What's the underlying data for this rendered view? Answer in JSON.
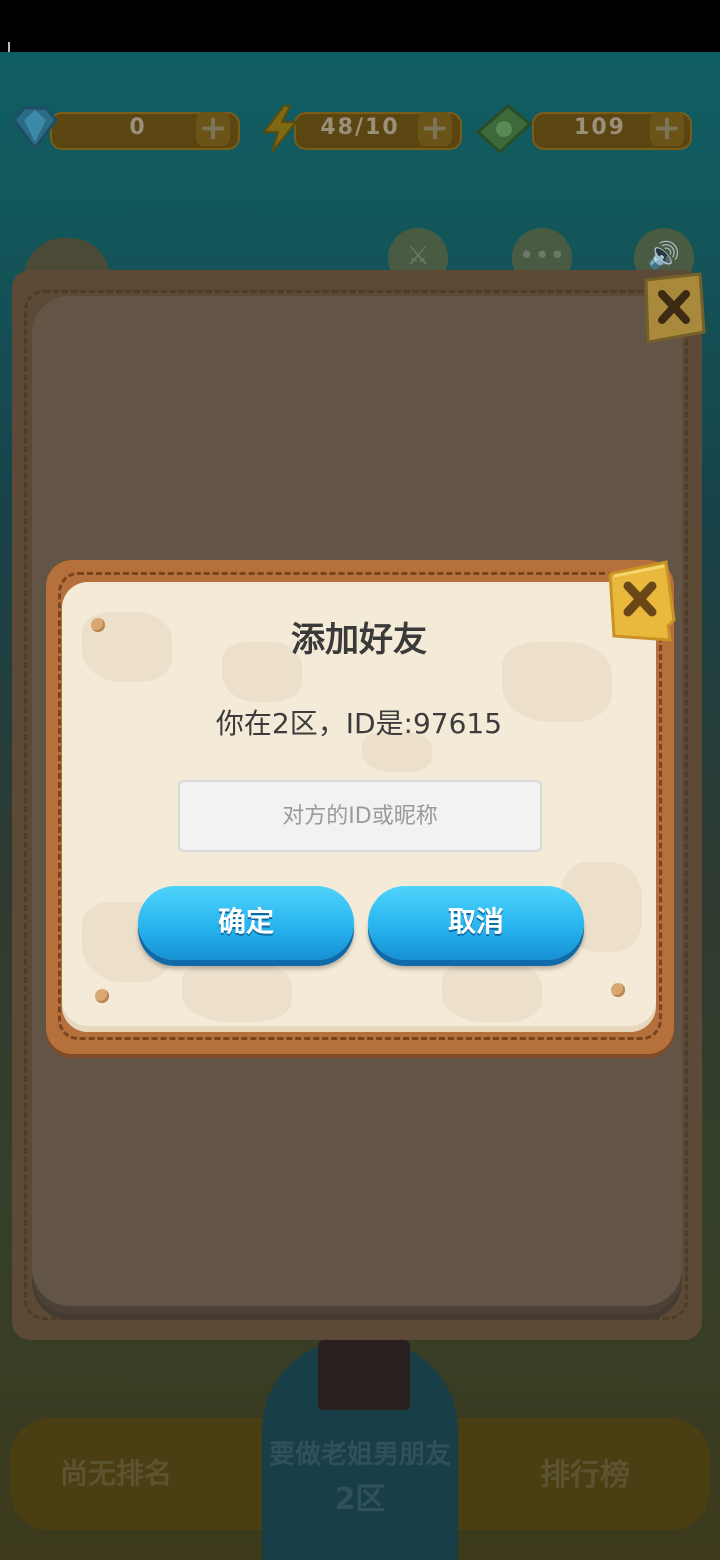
{
  "resources": {
    "gems": "0",
    "energy": "48/10",
    "cash": "109"
  },
  "bottom": {
    "rank": "尚无排名",
    "leaderboard": "排行榜",
    "nickname": "要做老姐男朋友",
    "zone": "2区"
  },
  "dialog": {
    "title": "添加好友",
    "info": "你在2区，ID是:97615",
    "input_placeholder": "对方的ID或昵称",
    "input_value": "",
    "confirm_label": "确定",
    "cancel_label": "取消"
  },
  "icons": [
    "gem-icon",
    "lightning-icon",
    "cash-icon",
    "plus-icon",
    "close-icon",
    "sword-icon",
    "more-icon",
    "sound-icon"
  ],
  "colors": {
    "button_blue": "#28b4ef",
    "paper": "#f4ead8",
    "frame_brown": "#b5703c",
    "close_tag": "#e8b93d"
  }
}
